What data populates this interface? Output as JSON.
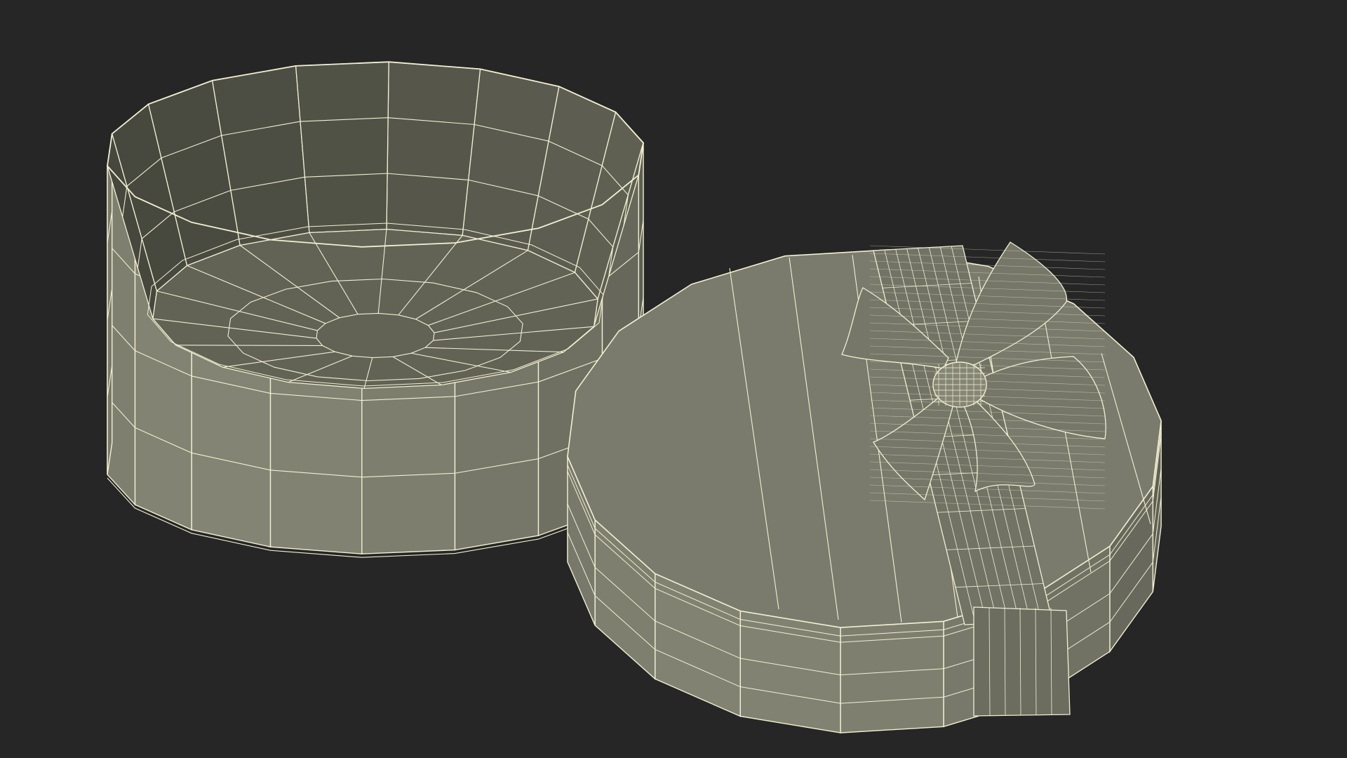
{
  "scene": {
    "background": "#262626",
    "surface_color": "#7f8070",
    "surface_shadow": "#5f6052",
    "interior_color": "#6a6b5c",
    "wire_color": "#f2efd2",
    "objects": [
      {
        "name": "box-base",
        "description_name": "open-round-gift-box-base",
        "segments": 18
      },
      {
        "name": "box-lid",
        "description_name": "round-gift-box-lid-with-bow",
        "segments": 18
      }
    ]
  }
}
